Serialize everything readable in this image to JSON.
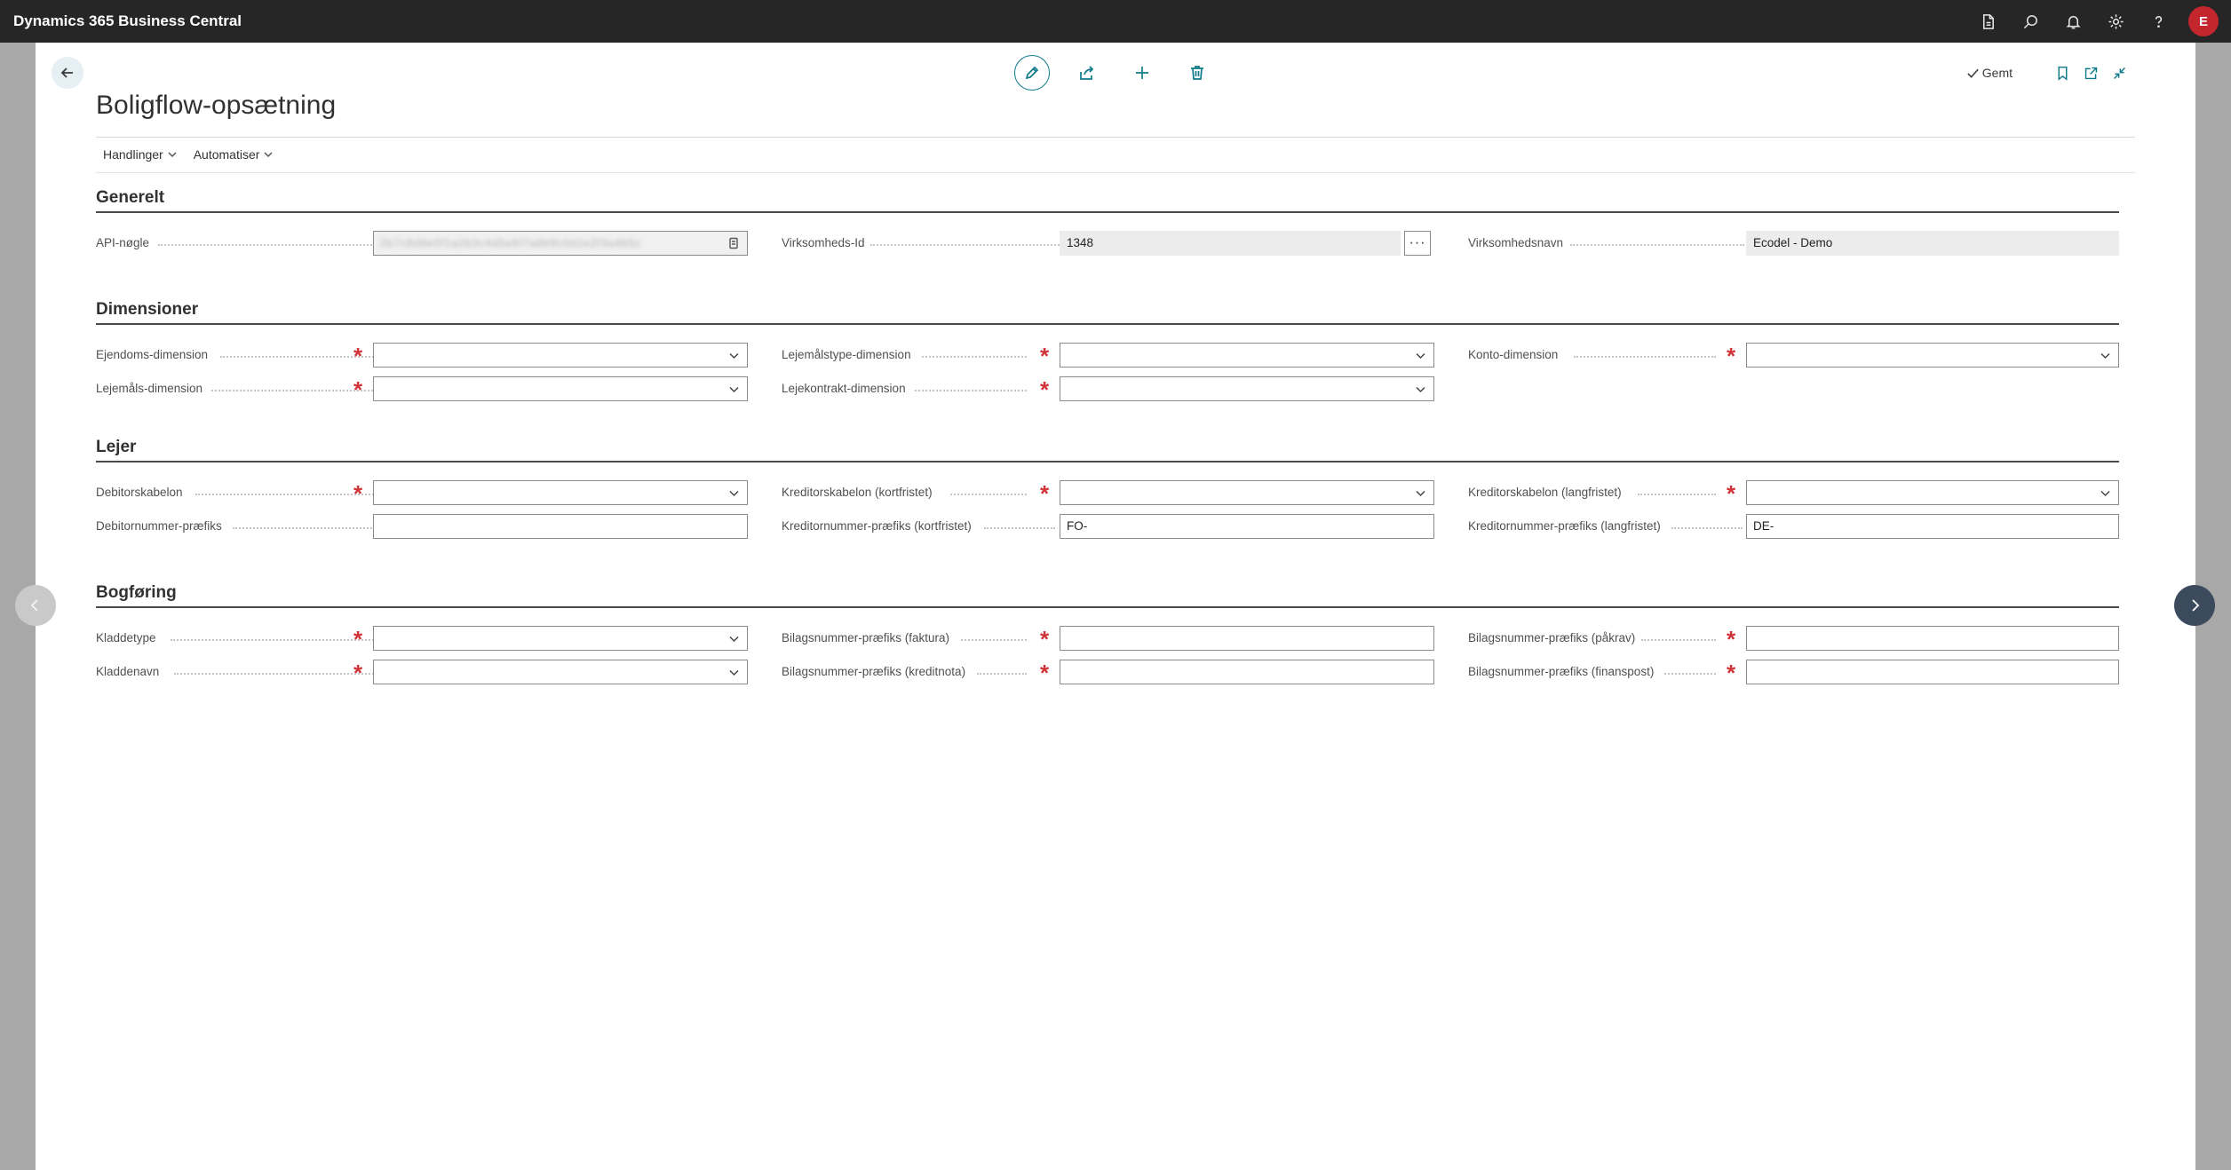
{
  "app": {
    "title": "Dynamics 365 Business Central",
    "user_initial": "E"
  },
  "topbar": {
    "icons": [
      "document-icon",
      "search-icon",
      "bell-icon",
      "gear-icon",
      "help-icon"
    ]
  },
  "page": {
    "title": "Boligflow-opsætning",
    "saved_label": "Gemt"
  },
  "menu": {
    "actions": "Handlinger",
    "automate": "Automatiser"
  },
  "sections": {
    "general": {
      "title": "Generelt",
      "api_key": {
        "label": "API-nøgle",
        "value": "2b7c8d9e0f1a2b3c4d5e6f7a8b9c0d1e2f3a4b5c"
      },
      "company_id": {
        "label": "Virksomheds-Id",
        "value": "1348"
      },
      "company_name": {
        "label": "Virksomhedsnavn",
        "value": "Ecodel - Demo"
      }
    },
    "dimensions": {
      "title": "Dimensioner",
      "property_dim": {
        "label": "Ejendoms-dimension",
        "value": ""
      },
      "unit_type_dim": {
        "label": "Lejemålstype-dimension",
        "value": ""
      },
      "account_dim": {
        "label": "Konto-dimension",
        "value": ""
      },
      "lease_dim": {
        "label": "Lejemåls-dimension",
        "value": ""
      },
      "contract_dim": {
        "label": "Lejekontrakt-dimension",
        "value": ""
      }
    },
    "tenant": {
      "title": "Lejer",
      "customer_template": {
        "label": "Debitorskabelon",
        "value": ""
      },
      "vendor_template_short": {
        "label": "Kreditorskabelon (kortfristet)",
        "value": ""
      },
      "vendor_template_long": {
        "label": "Kreditorskabelon (langfristet)",
        "value": ""
      },
      "customer_prefix": {
        "label": "Debitornummer-præfiks",
        "value": ""
      },
      "vendor_prefix_short": {
        "label": "Kreditornummer-præfiks (kortfristet)",
        "value": "FO-"
      },
      "vendor_prefix_long": {
        "label": "Kreditornummer-præfiks (langfristet)",
        "value": "DE-"
      }
    },
    "posting": {
      "title": "Bogføring",
      "journal_type": {
        "label": "Kladdetype",
        "value": ""
      },
      "doc_prefix_invoice": {
        "label": "Bilagsnummer-præfiks (faktura)",
        "value": ""
      },
      "doc_prefix_reminder": {
        "label": "Bilagsnummer-præfiks (påkrav)",
        "value": ""
      },
      "journal_name": {
        "label": "Kladdenavn",
        "value": ""
      },
      "doc_prefix_credit": {
        "label": "Bilagsnummer-præfiks (kreditnota)",
        "value": ""
      },
      "doc_prefix_finance": {
        "label": "Bilagsnummer-præfiks (finanspost)",
        "value": ""
      }
    }
  }
}
